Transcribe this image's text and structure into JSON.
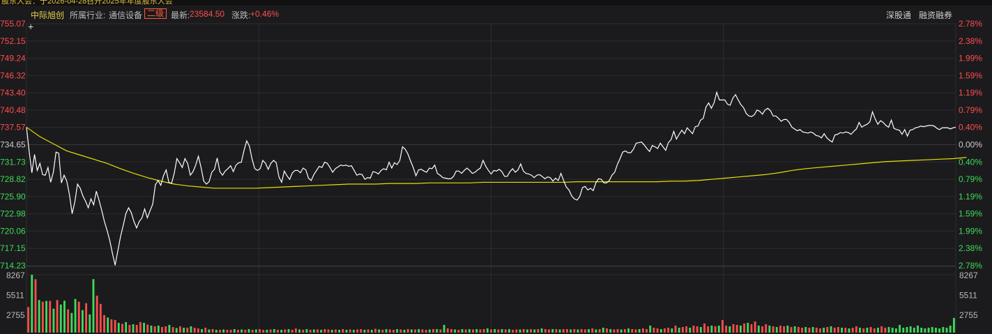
{
  "topbar": {
    "text": "股东大会：于2026-04-28召开2025年年度股东大会"
  },
  "header": {
    "stock_name": "中际旭创",
    "industry_label": "所属行业:",
    "industry": "通信设备",
    "level": "二级",
    "latest_label": "最新:",
    "latest": "23584.50",
    "change_label": "涨跌:",
    "change": "+0.46%",
    "button_sgt": "深股通",
    "button_margin": "融资融券"
  },
  "colors": {
    "background": "#1b1b1d",
    "up": "#ff4d4d",
    "down": "#3ddc5a",
    "price_line": "#ffffff",
    "avg_line": "#e8e000",
    "grid": "#2c2c30"
  },
  "chart_data": {
    "type": "line",
    "title": "",
    "y_left_labels": [
      "755.07",
      "752.15",
      "749.24",
      "746.32",
      "743.40",
      "740.48",
      "737.57",
      "734.65",
      "731.73",
      "728.82",
      "725.90",
      "722.98",
      "720.06",
      "717.15",
      "714.23"
    ],
    "y_right_labels": [
      "2.78%",
      "2.38%",
      "1.99%",
      "1.59%",
      "1.19%",
      "0.79%",
      "0.40%",
      "0.00%",
      "0.40%",
      "0.79%",
      "1.19%",
      "1.59%",
      "1.99%",
      "2.38%",
      "2.78%"
    ],
    "ylim": [
      714.23,
      755.07
    ],
    "prev_close": 734.65,
    "x_ticks": 240,
    "series": [
      {
        "kind": "price",
        "values": [
          737.6,
          733.5,
          729.9,
          733.0,
          730.3,
          731.5,
          729.6,
          729.5,
          730.8,
          728.3,
          730.0,
          733.4,
          733.2,
          728.2,
          729.5,
          728.5,
          726.2,
          723.0,
          725.0,
          728.0,
          727.3,
          726.0,
          725.1,
          724.0,
          725.5,
          724.5,
          726.8,
          725.3,
          723.6,
          721.7,
          720.2,
          718.5,
          716.3,
          714.3,
          716.7,
          719.1,
          721.0,
          723.0,
          724.0,
          723.2,
          721.7,
          720.6,
          721.7,
          722.3,
          723.8,
          722.3,
          723.5,
          724.6,
          727.9,
          728.6,
          727.8,
          729.4,
          730.4,
          728.3,
          728.1,
          729.8,
          732.3,
          731.6,
          730.8,
          732.3,
          731.5,
          729.5,
          730.1,
          731.2,
          732.7,
          730.8,
          728.5,
          728.0,
          728.4,
          730.0,
          730.5,
          732.4,
          730.1,
          729.5,
          730.2,
          730.6,
          731.1,
          730.1,
          731.2,
          731.6,
          731.7,
          733.7,
          735.3,
          734.4,
          732.2,
          730.6,
          730.3,
          730.6,
          732.0,
          731.5,
          730.5,
          731.5,
          732.0,
          731.6,
          729.2,
          728.3,
          730.2,
          729.4,
          728.8,
          729.9,
          730.3,
          730.3,
          729.9,
          730.7,
          730.4,
          729.0,
          728.6,
          729.6,
          730.3,
          731.0,
          730.8,
          731.7,
          731.5,
          730.8,
          730.0,
          730.6,
          730.9,
          731.2,
          731.1,
          731.2,
          731.0,
          731.1,
          730.3,
          729.5,
          729.7,
          729.6,
          728.8,
          729.1,
          729.0,
          730.1,
          730.0,
          729.7,
          730.3,
          730.6,
          730.4,
          731.7,
          730.7,
          731.6,
          731.3,
          732.0,
          734.3,
          733.9,
          733.1,
          731.9,
          730.8,
          729.4,
          730.4,
          730.5,
          730.2,
          730.0,
          730.7,
          730.6,
          731.2,
          729.8,
          729.5,
          729.1,
          729.0,
          728.9,
          728.9,
          729.3,
          730.2,
          730.2,
          729.8,
          730.3,
          730.7,
          730.3,
          729.8,
          730.0,
          730.4,
          730.7,
          732.0,
          731.0,
          730.3,
          729.7,
          730.3,
          730.2,
          730.5,
          730.1,
          729.3,
          729.3,
          730.1,
          730.6,
          730.0,
          730.4,
          731.4,
          730.2,
          729.8,
          729.7,
          729.5,
          729.1,
          729.5,
          729.6,
          729.3,
          728.9,
          729.2,
          729.1,
          728.5,
          729.0,
          728.6,
          729.8,
          728.6,
          727.5,
          727.0,
          726.0,
          725.5,
          725.3,
          725.9,
          727.4,
          727.6,
          727.0,
          727.3,
          726.9,
          728.2,
          728.9,
          728.8,
          728.2,
          728.2,
          728.6,
          729.5,
          730.0,
          731.3,
          732.3,
          733.4,
          733.6,
          733.3,
          733.3,
          733.9,
          734.9,
          735.0,
          735.1,
          734.6,
          734.0,
          733.5,
          734.5,
          734.3,
          734.0,
          734.9,
          734.3,
          733.7,
          735.0,
          735.5,
          736.9,
          735.6,
          736.4,
          737.1,
          736.5,
          737.5,
          737.0,
          736.5,
          737.7,
          737.8,
          738.8,
          739.1,
          741.0,
          741.7,
          740.8,
          741.7,
          743.5,
          742.2,
          742.2,
          742.2,
          741.5,
          741.3,
          742.5,
          743.1,
          742.2,
          741.4,
          740.9,
          739.9,
          739.5,
          739.4,
          739.7,
          740.5,
          740.3,
          739.8,
          740.5,
          740.8,
          740.4,
          739.5,
          739.5,
          739.1,
          738.6,
          738.9,
          738.9,
          738.4,
          737.6,
          737.3,
          737.0,
          737.2,
          736.8,
          736.7,
          736.6,
          736.8,
          736.6,
          736.2,
          736.1,
          735.8,
          736.5,
          735.8,
          735.4,
          735.1,
          736.3,
          736.4,
          736.7,
          736.6,
          736.8,
          736.7,
          736.4,
          736.9,
          737.3,
          738.4,
          737.6,
          737.9,
          738.1,
          738.5,
          740.2,
          739.0,
          738.1,
          738.7,
          738.4,
          737.9,
          737.6,
          738.8,
          737.4,
          737.2,
          737.1,
          736.4,
          737.2,
          736.1,
          737.1,
          737.2,
          737.5,
          737.6,
          737.8,
          737.7,
          737.8,
          737.9,
          737.9,
          737.8,
          737.4,
          737.2,
          737.5,
          737.5,
          737.5,
          737.3,
          737.5,
          737.6
        ]
      },
      {
        "kind": "average",
        "values": [
          737.6,
          736.0,
          734.8,
          733.6,
          732.9,
          732.2,
          731.5,
          730.6,
          729.8,
          729.1,
          728.5,
          728.0,
          727.7,
          727.5,
          727.3,
          727.3,
          727.3,
          727.3,
          727.4,
          727.5,
          727.6,
          727.7,
          727.8,
          727.9,
          728.0,
          728.0,
          728.0,
          728.1,
          728.1,
          728.1,
          728.2,
          728.2,
          728.2,
          728.2,
          728.3,
          728.3,
          728.3,
          728.3,
          728.3,
          728.3,
          728.3,
          728.4,
          728.4,
          728.4,
          728.4,
          728.4,
          728.4,
          728.4,
          728.5,
          728.5,
          728.6,
          728.8,
          729.0,
          729.2,
          729.4,
          729.6,
          729.9,
          730.3,
          730.6,
          730.8,
          731.0,
          731.2,
          731.4,
          731.6,
          731.8,
          731.9,
          732.0,
          732.1,
          732.2,
          732.3,
          732.5
        ]
      }
    ],
    "avg_x_index": [
      0,
      5,
      10,
      15,
      20,
      25,
      30,
      35,
      40,
      45,
      50,
      55,
      60,
      65,
      70,
      75,
      80,
      85,
      90,
      95,
      100,
      105,
      110,
      115,
      120,
      125,
      130,
      135,
      140,
      145,
      150,
      155,
      160,
      165,
      170,
      175,
      180,
      185,
      190,
      195,
      200,
      205,
      210,
      215,
      220,
      225,
      230,
      235,
      240,
      245,
      250,
      255,
      260,
      265,
      270,
      275,
      280,
      285,
      290,
      295,
      300,
      305,
      310,
      315,
      320,
      325,
      330,
      335,
      340,
      345,
      350
    ],
    "volume": {
      "axis_labels": [
        "8267",
        "5511",
        "2755"
      ],
      "ylim": [
        0,
        8267
      ],
      "values": [
        3650,
        8267,
        7617,
        4650,
        4413,
        4527,
        4523,
        3417,
        4650,
        4011,
        4557,
        3320,
        2808,
        4807,
        4407,
        3210,
        4200,
        2600,
        7640,
        5280,
        4100,
        2500,
        2150,
        1900,
        1800,
        1400,
        1250,
        1500,
        1100,
        1200,
        1100,
        1500,
        1400,
        1150,
        1000,
        900,
        1000,
        800,
        900,
        1100,
        800,
        650,
        900,
        700,
        700,
        900,
        700,
        600,
        500,
        700,
        450,
        500,
        400,
        400,
        450,
        400,
        400,
        500,
        400,
        450,
        400,
        500,
        400,
        450,
        500,
        400,
        400,
        450,
        500,
        400,
        400,
        450,
        500,
        400,
        600,
        450,
        400,
        500,
        400,
        450,
        450,
        400,
        500,
        450,
        400,
        450,
        400,
        500,
        400,
        450,
        400,
        450,
        500,
        400,
        450,
        400,
        550,
        450,
        400,
        500,
        450,
        400,
        500,
        450,
        400,
        500,
        450,
        450,
        500,
        450,
        400,
        450,
        500,
        500,
        450,
        1100,
        600,
        500,
        450,
        400,
        500,
        450,
        500,
        450,
        500,
        450,
        500,
        600,
        450,
        500,
        450,
        500,
        450,
        500,
        400,
        450,
        450,
        500,
        450,
        500,
        450,
        500,
        600,
        500,
        450,
        500,
        500,
        450,
        500,
        500,
        450,
        500,
        450,
        500,
        450,
        500,
        600,
        450,
        500,
        700,
        600,
        500,
        450,
        500,
        450,
        500,
        600,
        500,
        450,
        500,
        600,
        500,
        1000,
        700,
        600,
        500,
        600,
        700,
        600,
        1000,
        700,
        800,
        900,
        700,
        1000,
        900,
        800,
        1300,
        900,
        1000,
        900,
        1000,
        1800,
        1000,
        900,
        1200,
        1100,
        1000,
        1300,
        1400,
        1200,
        1600,
        1000,
        900,
        1200,
        1000,
        900,
        800,
        1000,
        900,
        1000,
        800,
        900,
        800,
        700,
        800,
        700,
        800,
        700,
        600,
        700,
        800,
        900,
        700,
        800,
        700,
        700,
        600,
        700,
        900,
        700,
        600,
        700,
        800,
        600,
        700,
        900,
        700,
        800,
        700,
        600,
        1100,
        700,
        800,
        900,
        700,
        1000,
        700,
        600,
        700,
        800,
        700,
        600,
        800,
        700,
        1000,
        2100
      ],
      "directions": [
        "up",
        "down",
        "up",
        "down",
        "up",
        "down",
        "up",
        "down",
        "up",
        "down",
        "down",
        "up",
        "down",
        "down",
        "up",
        "down",
        "up",
        "down",
        "down",
        "up",
        "up",
        "up",
        "down",
        "up",
        "up",
        "down",
        "up",
        "down",
        "up",
        "down",
        "up",
        "up",
        "down",
        "up",
        "down",
        "up",
        "down",
        "up",
        "up",
        "down",
        "up",
        "down",
        "up",
        "down",
        "up",
        "down",
        "up",
        "up",
        "down",
        "up",
        "down",
        "up",
        "down",
        "up",
        "down",
        "up",
        "up",
        "down",
        "up",
        "down",
        "up",
        "down",
        "up",
        "down",
        "up",
        "up",
        "down",
        "up",
        "down",
        "up",
        "down",
        "up",
        "down",
        "up",
        "up",
        "down",
        "up",
        "down",
        "up",
        "down",
        "up",
        "down",
        "up",
        "up",
        "down",
        "up",
        "down",
        "up",
        "down",
        "up",
        "down",
        "up",
        "up",
        "down",
        "up",
        "down",
        "up",
        "down",
        "up",
        "down",
        "up",
        "up",
        "down",
        "up",
        "down",
        "up",
        "down",
        "up",
        "down",
        "up",
        "up",
        "down",
        "up",
        "down",
        "up",
        "down",
        "up",
        "up",
        "down",
        "up",
        "down",
        "up",
        "down",
        "up",
        "down",
        "up",
        "up",
        "down",
        "up",
        "down",
        "up",
        "down",
        "up",
        "down",
        "up",
        "up",
        "down",
        "up",
        "down",
        "up",
        "down",
        "up",
        "down",
        "up",
        "up",
        "down",
        "up",
        "down",
        "up",
        "up",
        "down",
        "up",
        "down",
        "up",
        "up",
        "down",
        "up",
        "down",
        "up",
        "down",
        "up",
        "down",
        "up",
        "up",
        "down",
        "up",
        "down",
        "up",
        "up",
        "down",
        "up",
        "up",
        "down",
        "up",
        "up",
        "down",
        "up",
        "up",
        "down",
        "up",
        "down",
        "up",
        "up",
        "down",
        "up",
        "up",
        "down",
        "up",
        "up",
        "down",
        "up",
        "down",
        "up",
        "up",
        "down",
        "up",
        "up",
        "down",
        "up",
        "down",
        "up",
        "up",
        "down",
        "up",
        "up",
        "down",
        "up",
        "down",
        "up",
        "up",
        "down",
        "up",
        "down",
        "up",
        "up",
        "down",
        "up",
        "down",
        "up",
        "up",
        "down",
        "up",
        "down",
        "up",
        "up",
        "down",
        "up",
        "down",
        "up",
        "up",
        "down",
        "up",
        "down",
        "up",
        "up",
        "down",
        "up",
        "up"
      ]
    }
  }
}
